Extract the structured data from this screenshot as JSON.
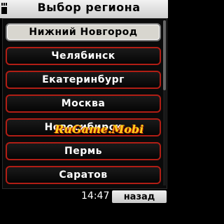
{
  "header": {
    "title": "Выбор региона",
    "icon": "signal-icon"
  },
  "regions": [
    "Нижний Новгород",
    "Челябинск",
    "Екатеринбург",
    "Москва",
    "Новосибирск",
    "Пермь",
    "Саратов"
  ],
  "selected_index": 0,
  "watermark": "RuGame.Mobi",
  "footer": {
    "time": "14:47",
    "back_label": "назад"
  },
  "colors": {
    "item_border": "#b01e15",
    "selected_bg": "#d8d6cf",
    "watermark": "#ffd21a"
  }
}
